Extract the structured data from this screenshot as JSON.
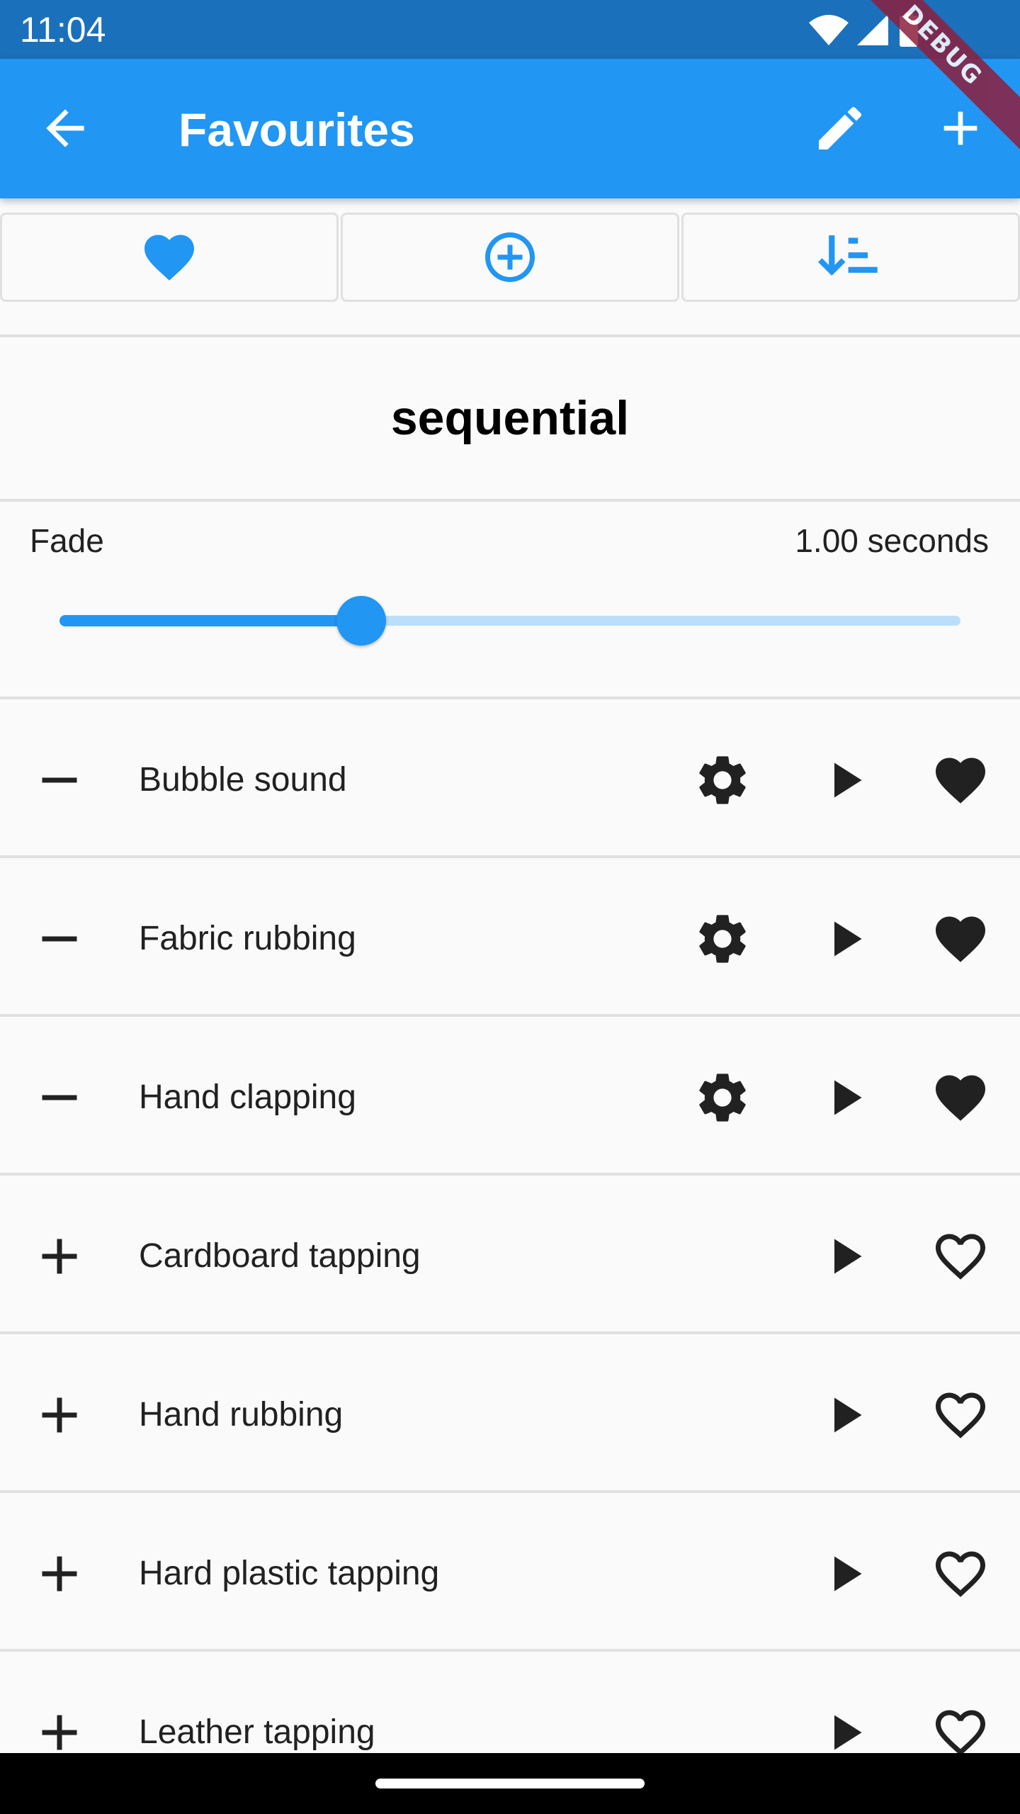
{
  "status_bar": {
    "time": "11:04",
    "icons": [
      "wifi-icon",
      "cellular-signal-icon",
      "battery-icon"
    ]
  },
  "debug_banner": "DEBUG",
  "app_bar": {
    "title": "Favourites",
    "back_icon": "arrow-back-icon",
    "edit_icon": "edit-pencil-icon",
    "add_icon": "add-icon",
    "background_color": "#2196F3"
  },
  "toggles": [
    {
      "icon": "heart-icon",
      "selected": true
    },
    {
      "icon": "add-circle-outline-icon",
      "selected": false
    },
    {
      "icon": "sort-icon",
      "selected": false
    }
  ],
  "section_title": "sequential",
  "fade": {
    "label": "Fade",
    "value_text": "1.00 seconds",
    "slider_fraction": 0.335
  },
  "sounds": [
    {
      "name": "Bubble sound",
      "in_sequence": true,
      "favourite": true,
      "has_settings": true
    },
    {
      "name": "Fabric rubbing",
      "in_sequence": true,
      "favourite": true,
      "has_settings": true
    },
    {
      "name": "Hand clapping",
      "in_sequence": true,
      "favourite": true,
      "has_settings": true
    },
    {
      "name": "Cardboard tapping",
      "in_sequence": false,
      "favourite": false,
      "has_settings": false
    },
    {
      "name": "Hand rubbing",
      "in_sequence": false,
      "favourite": false,
      "has_settings": false
    },
    {
      "name": "Hard plastic tapping",
      "in_sequence": false,
      "favourite": false,
      "has_settings": false
    },
    {
      "name": "Leather tapping",
      "in_sequence": false,
      "favourite": false,
      "has_settings": false
    }
  ],
  "colors": {
    "accent": "#2196F3",
    "status_bar": "#1B70BB",
    "icon_dark": "#212121"
  }
}
